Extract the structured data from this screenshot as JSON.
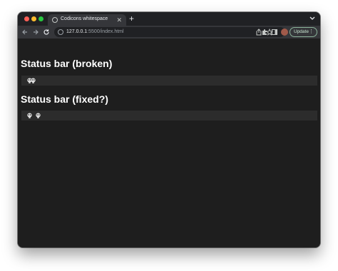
{
  "browser": {
    "tab": {
      "title": "Codicons whitespace",
      "close_icon": "close-icon"
    },
    "new_tab_icon": "plus-icon",
    "url": {
      "host": "127.0.0.1",
      "rest": ":5500/index.html"
    },
    "update_label": "Update"
  },
  "page": {
    "heading_broken": "Status bar (broken)",
    "heading_fixed": "Status bar (fixed?)",
    "status_icon": "copilot-icon"
  }
}
